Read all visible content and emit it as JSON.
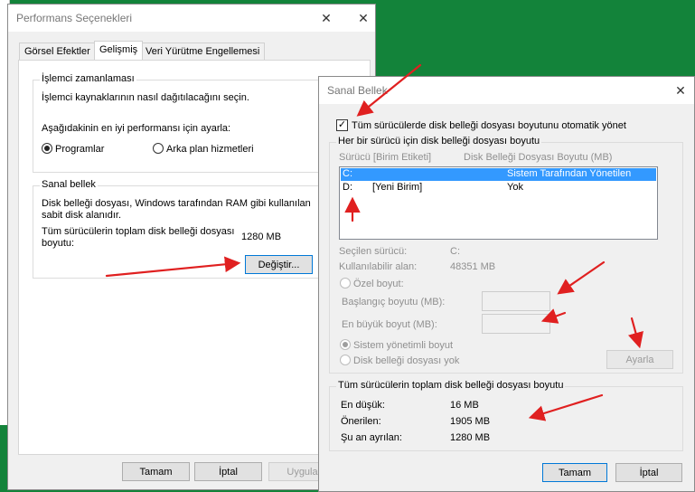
{
  "perf": {
    "title": "Performans Seçenekleri",
    "tabs": [
      "Görsel Efektler",
      "Gelişmiş",
      "Veri Yürütme Engellemesi"
    ],
    "scheduling": {
      "title": "İşlemci zamanlaması",
      "desc": "İşlemci kaynaklarının nasıl dağıtılacağını seçin.",
      "adjust": "Aşağıdakinin en iyi performansı için ayarla:",
      "opt_programs": "Programlar",
      "opt_background": "Arka plan hizmetleri"
    },
    "virtual": {
      "title": "Sanal bellek",
      "desc": "Disk belleği dosyası, Windows tarafından RAM gibi kullanılan sabit disk alanıdır.",
      "total_label": "Tüm sürücülerin toplam disk belleği dosyası boyutu:",
      "total_value": "1280 MB",
      "change": "Değiştir..."
    },
    "buttons": {
      "ok": "Tamam",
      "cancel": "İptal",
      "apply": "Uygula"
    }
  },
  "vm": {
    "title": "Sanal Bellek",
    "auto_manage": "Tüm sürücülerde disk belleği dosyası boyutunu otomatik yönet",
    "auto_checked": true,
    "per_drive": "Her bir sürücü için disk belleği dosyası boyutu",
    "col_drive": "Sürücü  [Birim Etiketi]",
    "col_size": "Disk Belleği Dosyası Boyutu (MB)",
    "drives": [
      {
        "drive": "C:",
        "label": "",
        "size": "Sistem Tarafından Yönetilen",
        "selected": true
      },
      {
        "drive": "D:",
        "label": "[Yeni Birim]",
        "size": "Yok",
        "selected": false
      }
    ],
    "selected_drive_label": "Seçilen sürücü:",
    "selected_drive_value": "C:",
    "free_space_label": "Kullanılabilir alan:",
    "free_space_value": "48351 MB",
    "custom_size": "Özel boyut:",
    "initial_size": "Başlangıç boyutu (MB):",
    "max_size": "En büyük boyut (MB):",
    "system_managed": "Sistem yönetimli boyut",
    "no_paging": "Disk belleği dosyası yok",
    "set": "Ayarla",
    "totals_title": "Tüm sürücülerin toplam disk belleği dosyası boyutu",
    "min_label": "En düşük:",
    "min_value": "16 MB",
    "rec_label": "Önerilen:",
    "rec_value": "1905 MB",
    "cur_label": "Şu an ayrılan:",
    "cur_value": "1280 MB",
    "ok": "Tamam",
    "cancel": "İptal"
  },
  "colors": {
    "desktop": "#13833a",
    "selection": "#3399ff",
    "arrow": "#e02020"
  }
}
